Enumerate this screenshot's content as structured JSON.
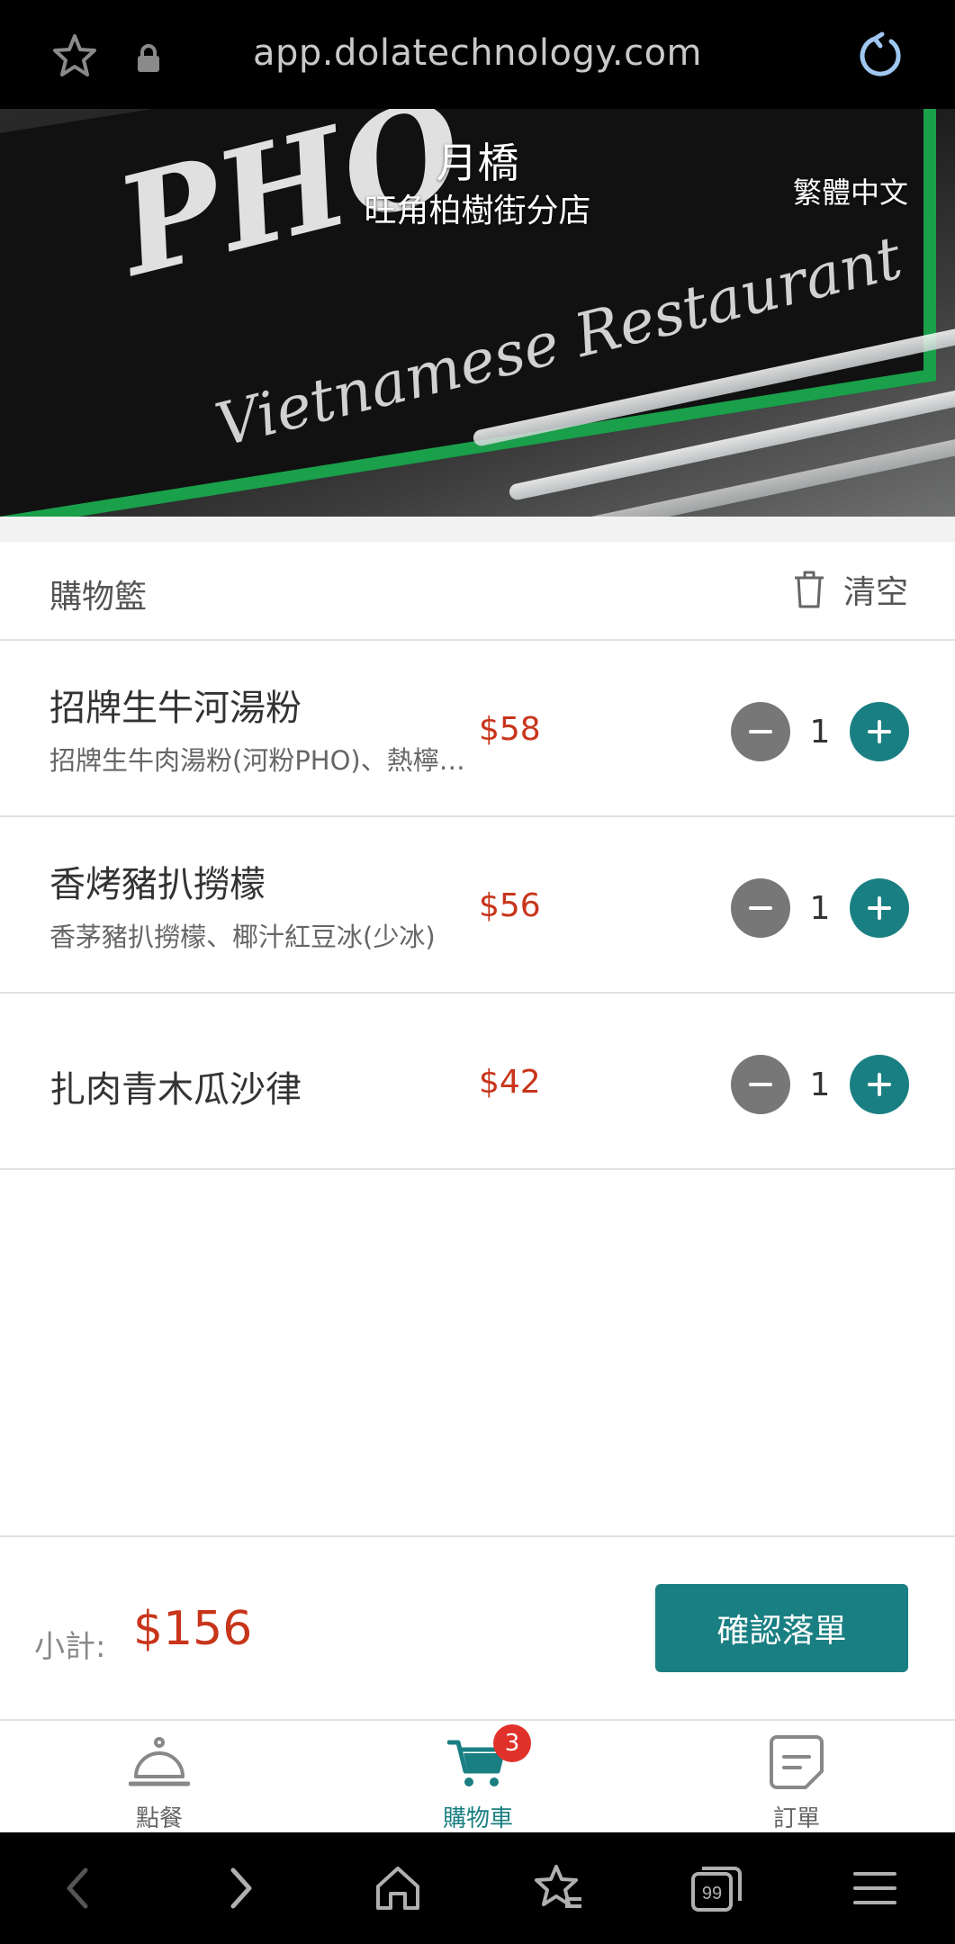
{
  "browser": {
    "url": "app.dolatechnology.com"
  },
  "banner": {
    "restaurant_name": "月橋",
    "branch_name": "旺角柏樹街分店",
    "language_selector": "繁體中文",
    "sign_text_pho": "PHO",
    "sign_text_english": "Vietnamese Restaurant"
  },
  "cart": {
    "title": "購物籃",
    "clear_label": "清空",
    "items": [
      {
        "name": "招牌生牛河湯粉",
        "description": "招牌生牛肉湯粉(河粉PHO)、熱檸檬茶",
        "price": "$58",
        "quantity": "1"
      },
      {
        "name": "香烤豬扒撈檬",
        "description": "香茅豬扒撈檬、椰汁紅豆冰(少冰)",
        "price": "$56",
        "quantity": "1"
      },
      {
        "name": "扎肉青木瓜沙律",
        "description": "",
        "price": "$42",
        "quantity": "1"
      }
    ]
  },
  "footer": {
    "subtotal_label": "小計:",
    "subtotal_amount": "$156",
    "confirm_button": "確認落單"
  },
  "tabs": [
    {
      "label": "點餐",
      "icon": "cloche-icon"
    },
    {
      "label": "購物車",
      "icon": "cart-icon",
      "badge": "3",
      "active": true
    },
    {
      "label": "訂單",
      "icon": "order-icon"
    }
  ],
  "colors": {
    "accent": "#1a7f82",
    "price": "#c8351b",
    "badge": "#e0322a"
  }
}
